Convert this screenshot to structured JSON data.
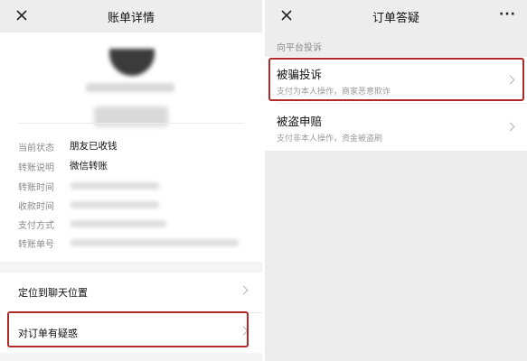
{
  "left_screen": {
    "title": "账单详情",
    "details": [
      {
        "label": "当前状态",
        "value": "朋友已收钱"
      },
      {
        "label": "转账说明",
        "value": "微信转账"
      },
      {
        "label": "转账时间",
        "value": ""
      },
      {
        "label": "收款时间",
        "value": ""
      },
      {
        "label": "支付方式",
        "value": ""
      },
      {
        "label": "转账单号",
        "value": ""
      }
    ],
    "menu": {
      "locate_chat": "定位到聊天位置",
      "question_order": "对订单有疑惑"
    }
  },
  "right_screen": {
    "title": "订单答疑",
    "more_icon": "···",
    "section_header": "向平台投诉",
    "options": [
      {
        "title": "被骗投诉",
        "desc": "支付为本人操作，商家恶意欺诈"
      },
      {
        "title": "被盗申赔",
        "desc": "支付非本人操作，资金被盗刷"
      }
    ]
  },
  "colors": {
    "highlight_border": "#b02a2a",
    "nav_background": "#ededed",
    "page_background_right": "#ededed"
  },
  "icons": {
    "close": "close-icon",
    "chevron": "chevron-right-icon",
    "more": "more-icon"
  }
}
